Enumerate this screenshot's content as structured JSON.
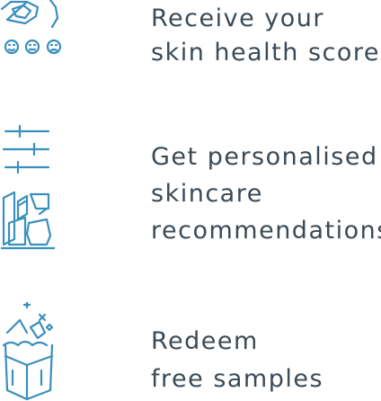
{
  "colors": {
    "text": "#3b4a56",
    "icon_stroke": "#3a8fbd"
  },
  "features": [
    {
      "icon": "face-score-icon",
      "lines": [
        "Receive your",
        "skin health score"
      ]
    },
    {
      "icon": "skincare-products-icon",
      "lines": [
        "Get personalised",
        "skincare",
        "recommendations"
      ]
    },
    {
      "icon": "gift-samples-icon",
      "lines": [
        "Redeem",
        "free samples"
      ]
    }
  ]
}
